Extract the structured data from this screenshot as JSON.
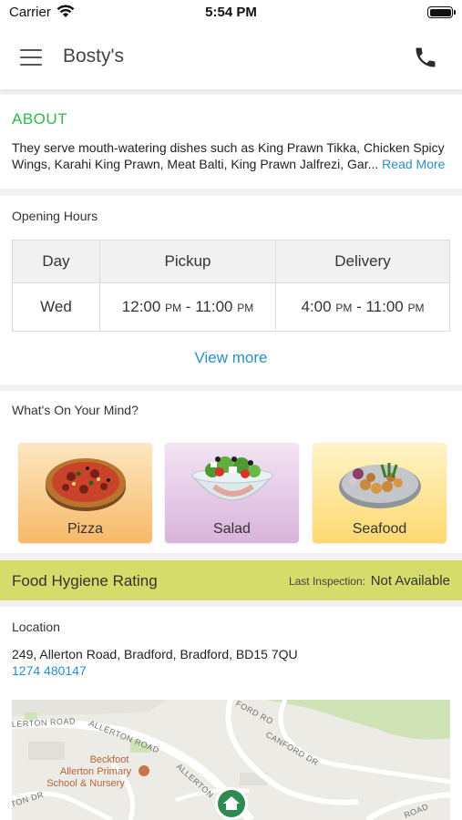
{
  "status_bar": {
    "carrier": "Carrier",
    "time": "5:54 PM",
    "icons": [
      "wifi-icon",
      "battery-icon"
    ]
  },
  "nav": {
    "title": "Bosty's",
    "menu_icon": "hamburger-menu-icon",
    "call_icon": "phone-icon"
  },
  "about": {
    "heading": "ABOUT",
    "text": "They serve mouth-watering dishes such as King Prawn Tikka, Chicken Spicy Wings, Karahi King Prawn, Meat Balti, King Prawn Jalfrezi, Gar...",
    "read_more": "Read More"
  },
  "opening_hours": {
    "heading": "Opening Hours",
    "columns": [
      "Day",
      "Pickup",
      "Delivery"
    ],
    "row": {
      "day": "Wed",
      "pickup_open": "12:00",
      "pickup_open_period": "PM",
      "pickup_close": "11:00",
      "pickup_close_period": "PM",
      "delivery_open": "4:00",
      "delivery_open_period": "PM",
      "delivery_close": "11:00",
      "delivery_close_period": "PM"
    },
    "view_more": "View more"
  },
  "whats_on_your_mind": {
    "heading": "What's On Your Mind?",
    "categories": [
      {
        "label": "Pizza",
        "icon": "pizza-image"
      },
      {
        "label": "Salad",
        "icon": "salad-image"
      },
      {
        "label": "Seafood",
        "icon": "seafood-image"
      }
    ]
  },
  "hygiene": {
    "title": "Food Hygiene Rating",
    "last_inspection_label": "Last Inspection:",
    "last_inspection_value": "Not Available"
  },
  "location": {
    "heading": "Location",
    "address": "249, Allerton Road, Bradford, Bradford, BD15 7QU",
    "phone": "1274 480147",
    "map": {
      "road_label_1": "LERTON ROAD",
      "road_label_2": "ALLERTON ROAD",
      "road_label_3": "ALLERTON",
      "road_label_4": "CANFORD DR",
      "road_label_5": "FORD RO",
      "road_label_6": "TON DR",
      "road_label_7": "ROAD",
      "poi_line_1": "Beckfoot",
      "poi_line_2": "Allerton Primary",
      "poi_line_3": "School & Nursery",
      "marker_icon": "home-marker-icon"
    }
  },
  "colors": {
    "about_heading": "#2fb84a",
    "link": "#2a8fc4",
    "hygiene_bar": "#d6dc6a"
  }
}
